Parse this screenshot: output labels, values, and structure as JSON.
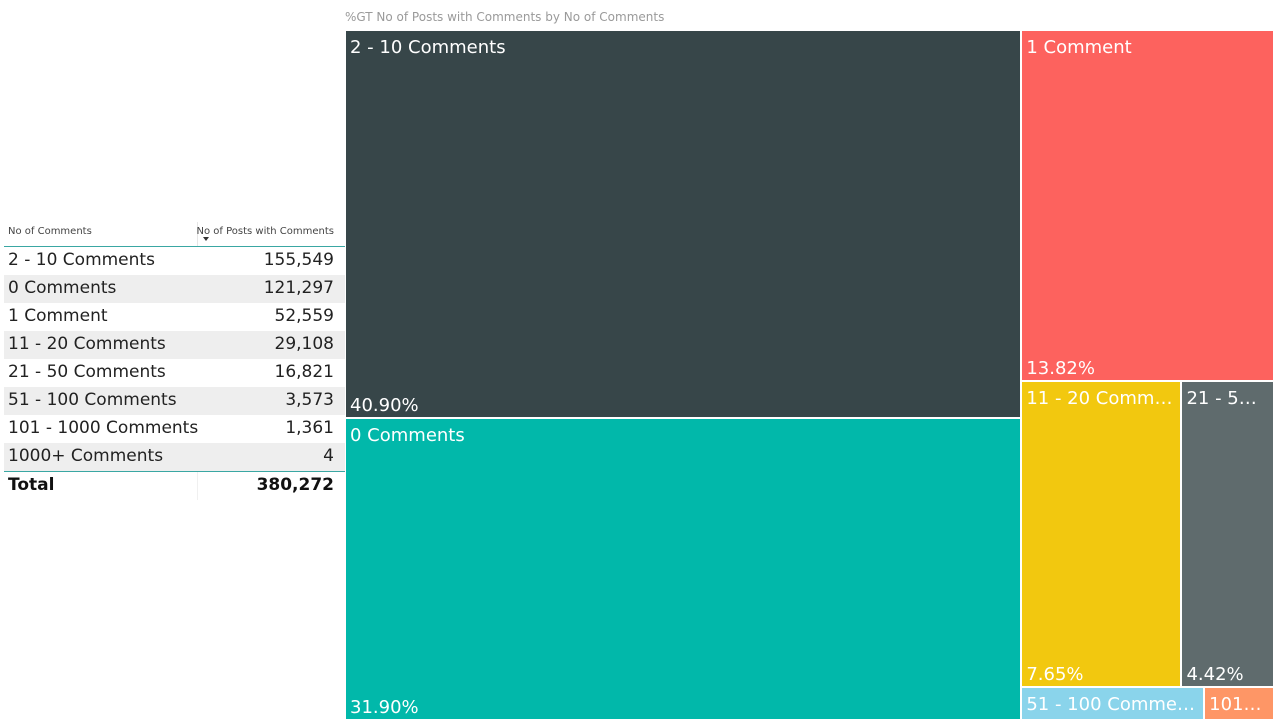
{
  "table": {
    "headers": {
      "category": "No of Comments",
      "value": "No of Posts with Comments"
    },
    "rows": [
      {
        "category": "2 - 10 Comments",
        "value": "155,549"
      },
      {
        "category": "0 Comments",
        "value": "121,297"
      },
      {
        "category": "1 Comment",
        "value": "52,559"
      },
      {
        "category": "11 - 20 Comments",
        "value": "29,108"
      },
      {
        "category": "21 - 50 Comments",
        "value": "16,821"
      },
      {
        "category": "51 - 100 Comments",
        "value": "3,573"
      },
      {
        "category": "101 - 1000 Comments",
        "value": "1,361"
      },
      {
        "category": "1000+ Comments",
        "value": "4"
      }
    ],
    "total": {
      "label": "Total",
      "value": "380,272"
    }
  },
  "chart_data": {
    "type": "treemap",
    "title": "%GT No of Posts with Comments by No of Comments",
    "items": [
      {
        "name": "2 - 10 Comments",
        "display_name": "2 - 10 Comments",
        "value": 155549,
        "pct_label": "40.90%",
        "color": "#374649"
      },
      {
        "name": "0 Comments",
        "display_name": "0 Comments",
        "value": 121297,
        "pct_label": "31.90%",
        "color": "#01b8aa"
      },
      {
        "name": "1 Comment",
        "display_name": "1 Comment",
        "value": 52559,
        "pct_label": "13.82%",
        "color": "#fd625e"
      },
      {
        "name": "11 - 20 Comments",
        "display_name": "11 - 20 Comme...",
        "value": 29108,
        "pct_label": "7.65%",
        "color": "#f2c80f"
      },
      {
        "name": "21 - 50 Comments",
        "display_name": "21 - 50 ...",
        "value": 16821,
        "pct_label": "4.42%",
        "color": "#5f6b6d"
      },
      {
        "name": "51 - 100 Comments",
        "display_name": "51 - 100 Comments",
        "value": 3573,
        "pct_label": "",
        "color": "#8ad4eb"
      },
      {
        "name": "101 - 1000 Comments",
        "display_name": "101 -...",
        "value": 1361,
        "pct_label": "",
        "color": "#fe9666"
      },
      {
        "name": "1000+ Comments",
        "display_name": "",
        "value": 4,
        "pct_label": "",
        "color": "#a66999"
      }
    ]
  }
}
